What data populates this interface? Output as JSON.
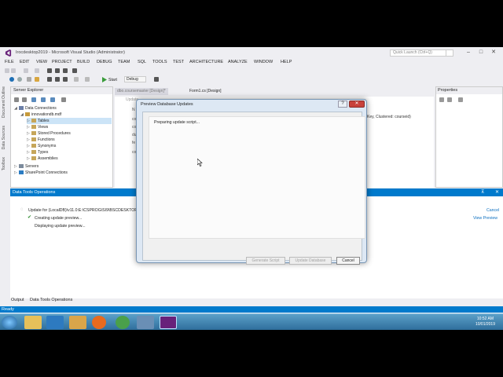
{
  "window": {
    "title": "Irocdesktop2019 - Microsoft Visual Studio (Administrator)",
    "quick_launch_placeholder": "Quick Launch (Ctrl+Q)"
  },
  "menu": [
    "FILE",
    "EDIT",
    "VIEW",
    "PROJECT",
    "BUILD",
    "DEBUG",
    "TEAM",
    "SQL",
    "TOOLS",
    "TEST",
    "ARCHITECTURE",
    "ANALYZE",
    "WINDOW",
    "HELP"
  ],
  "toolbar": {
    "start_label": "Start",
    "config_value": "Debug"
  },
  "left_strip": [
    "Document Outline",
    "Data Sources",
    "Toolbox"
  ],
  "server_explorer": {
    "title": "Server Explorer",
    "tree": [
      {
        "label": "Data Connections",
        "depth": 0
      },
      {
        "label": "innovationdb.mdf",
        "depth": 1
      },
      {
        "label": "Tables",
        "depth": 2,
        "selected": true
      },
      {
        "label": "Views",
        "depth": 2
      },
      {
        "label": "Stored Procedures",
        "depth": 2
      },
      {
        "label": "Functions",
        "depth": 2
      },
      {
        "label": "Synonyms",
        "depth": 2
      },
      {
        "label": "Types",
        "depth": 2
      },
      {
        "label": "Assemblies",
        "depth": 2
      },
      {
        "label": "Servers",
        "depth": 0
      },
      {
        "label": "SharePoint Connections",
        "depth": 0
      }
    ]
  },
  "editor": {
    "tabs": [
      "dbo.coursemaster [Design]*",
      "Form1.cs [Design]"
    ],
    "update_label": "Update",
    "column_fragments": [
      "N",
      "co",
      "co",
      "du",
      "fe",
      "co"
    ],
    "key_text": "Key, Clustered: courseid)"
  },
  "properties": {
    "title": "Properties"
  },
  "data_tools": {
    "title": "Data Tools Operations",
    "lines": [
      "Update for (LocalDB)\\v11.0:E:\\CSPROG\\SI9\\BSCDESKTOP2",
      "Creating update preview...",
      "Displaying update preview..."
    ],
    "cancel_link": "Cancel",
    "view_preview_link": "View Preview"
  },
  "bottom_tabs": [
    "Output",
    "Data Tools Operations"
  ],
  "status": "Ready",
  "dialog": {
    "title": "Preview Database Updates",
    "help_glyph": "?",
    "close_glyph": "✕",
    "message": "Preparing update script...",
    "generate_script": "Generate Script",
    "update_database": "Update Database",
    "cancel": "Cancel"
  },
  "taskbar": {
    "time": "10:52 AM",
    "date": "10/01/2019"
  },
  "colors": {
    "accent": "#007acc",
    "dialog_frame": "#dde8f4",
    "close_red": "#c8423b"
  }
}
